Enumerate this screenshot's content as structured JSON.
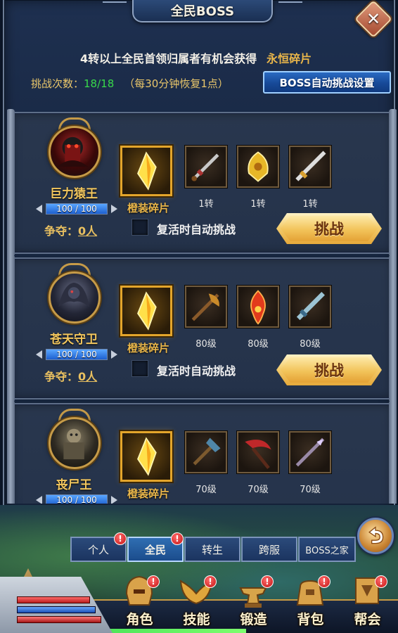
{
  "window": {
    "title": "全民BOSS",
    "close_symbol": "✕"
  },
  "notice": {
    "text": "4转以上全民首领归属者有机会获得",
    "item": "永恒碎片"
  },
  "challenge": {
    "label": "挑战次数：",
    "count": "18/18",
    "recover": "（每30分钟恢复1点）",
    "auto_button": "BOSS自动挑战设置"
  },
  "bosses": [
    {
      "name": "巨力猿王",
      "hp": "100 / 100",
      "hp_fraction": 1.0,
      "contest_label": "争夺：",
      "contest_value": "0人",
      "shard_label": "橙装碎片",
      "drops": [
        "1转",
        "1转",
        "1转"
      ],
      "auto_label": "复活时自动挑战",
      "fight_label": "挑战",
      "avatar_color": "#8a1c1c"
    },
    {
      "name": "苍天守卫",
      "hp": "100 / 100",
      "hp_fraction": 1.0,
      "contest_label": "争夺：",
      "contest_value": "0人",
      "shard_label": "橙装碎片",
      "drops": [
        "80级",
        "80级",
        "80级"
      ],
      "auto_label": "复活时自动挑战",
      "fight_label": "挑战",
      "avatar_color": "#4a4f66"
    },
    {
      "name": "丧尸王",
      "hp": "100 / 100",
      "hp_fraction": 1.0,
      "shard_label": "橙装碎片",
      "drops": [
        "70级",
        "70级",
        "70级"
      ],
      "avatar_color": "#6b6252"
    }
  ],
  "tabs": [
    {
      "label": "个人",
      "badge": "!"
    },
    {
      "label": "全民",
      "badge": "!"
    },
    {
      "label": "转生",
      "badge": ""
    },
    {
      "label": "跨服",
      "badge": ""
    },
    {
      "label": "BOSS之家",
      "badge": ""
    }
  ],
  "menu": [
    {
      "label": "角色",
      "badge": "!",
      "icon": "helmet-icon"
    },
    {
      "label": "技能",
      "badge": "!",
      "icon": "wings-icon"
    },
    {
      "label": "锻造",
      "badge": "!",
      "icon": "anvil-icon"
    },
    {
      "label": "背包",
      "badge": "!",
      "icon": "bag-icon"
    },
    {
      "label": "帮会",
      "badge": "!",
      "icon": "banner-icon"
    }
  ],
  "colors": {
    "accent_gold": "#e9b64a",
    "count_green": "#38d94a",
    "badge_red": "#c41414"
  }
}
